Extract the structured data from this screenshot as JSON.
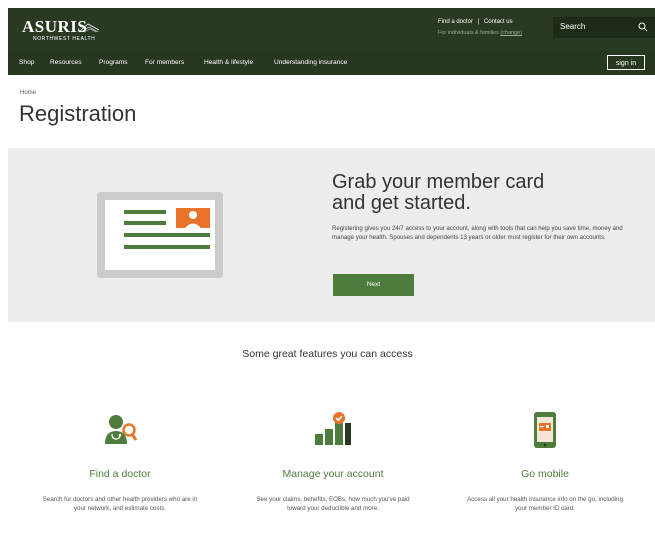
{
  "header": {
    "logo_main": "ASURIS",
    "logo_sub": "NORTHWEST HEALTH",
    "find_doctor": "Find a doctor",
    "separator": "|",
    "contact_us": "Contact us",
    "audience_prefix": "For individuals & families",
    "audience_change": "(change)",
    "search_label": "Search"
  },
  "nav": {
    "items": [
      "Shop",
      "Resources",
      "Programs",
      "For members",
      "Health & lifestyle",
      "Understanding insurance"
    ],
    "sign_in": "sign in"
  },
  "breadcrumb": "Home",
  "page_title": "Registration",
  "hero": {
    "title_line1": "Grab your member card",
    "title_line2": "and get started.",
    "body": "Registering gives you 24/7 access to your account, along with tools that can help you save time, money and manage your health. Spouses and dependents 13 years or older must register for their own accounts.",
    "button": "Next"
  },
  "features": {
    "heading": "Some great features you can access",
    "items": [
      {
        "title": "Find a doctor",
        "desc": "Search for doctors and other health providers who are in your network, and estimate costs.",
        "icon": "doctor-search-icon"
      },
      {
        "title": "Manage your account",
        "desc": "See your claims, benefits, EOBs, how much you've paid toward your deductible and more.",
        "icon": "bar-chart-check-icon"
      },
      {
        "title": "Go mobile",
        "desc": "Access all your health insurance info on the go, including your member ID card.",
        "icon": "mobile-card-icon"
      }
    ]
  },
  "colors": {
    "header_bg": "#2a3a22",
    "nav_bg": "#273720",
    "accent_green": "#4d7c3c",
    "accent_orange": "#e8742c",
    "hero_bg": "#ededed"
  }
}
